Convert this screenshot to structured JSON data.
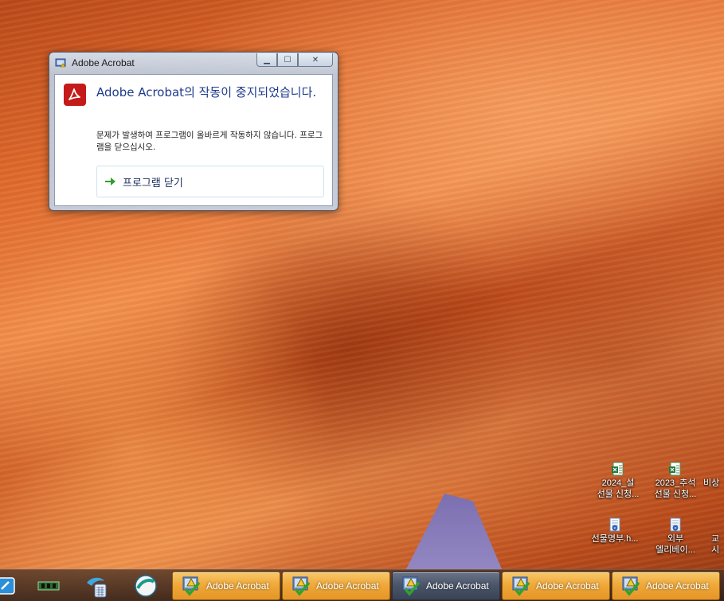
{
  "dialog": {
    "title": "Adobe Acrobat",
    "heading": "Adobe Acrobat의 작동이 중지되었습니다.",
    "message": "문제가 발생하여 프로그램이 올바르게 작동하지 않습니다. 프로그램을 닫으십시오.",
    "close_program_label": "프로그램 닫기",
    "minimize_glyph": "▁",
    "maximize_glyph": "☐",
    "close_glyph": "✕"
  },
  "desktop_icons": [
    {
      "line1": "2024_설",
      "line2": "선물 신청...",
      "icon": "spreadsheet-icon"
    },
    {
      "line1": "2023_추석",
      "line2": "선물 신청...",
      "icon": "spreadsheet-icon"
    },
    {
      "line1": "비상",
      "line2": "",
      "icon": "document-icon"
    },
    {
      "line1": "선물명부.h...",
      "line2": "",
      "icon": "hwp-document-icon"
    },
    {
      "line1": "외부",
      "line2": "엘리베이...",
      "icon": "hwp-document-icon"
    },
    {
      "line1": "교",
      "line2": "시",
      "icon": "document-icon"
    }
  ],
  "taskbar": {
    "quick_launch": [
      "edit-icon",
      "memory-chip-icon",
      "dolphin-calculator-icon",
      "sphere-app-icon"
    ],
    "buttons": [
      {
        "label": "Adobe Acrobat",
        "active": false
      },
      {
        "label": "Adobe Acrobat",
        "active": false
      },
      {
        "label": "Adobe Acrobat",
        "active": true
      },
      {
        "label": "Adobe Acrobat",
        "active": false
      },
      {
        "label": "Adobe Acrobat",
        "active": false
      }
    ]
  },
  "colors": {
    "heading": "#1e3a8c",
    "acrobat_red": "#c41a1a",
    "taskbar_button": "#f0a93a"
  }
}
